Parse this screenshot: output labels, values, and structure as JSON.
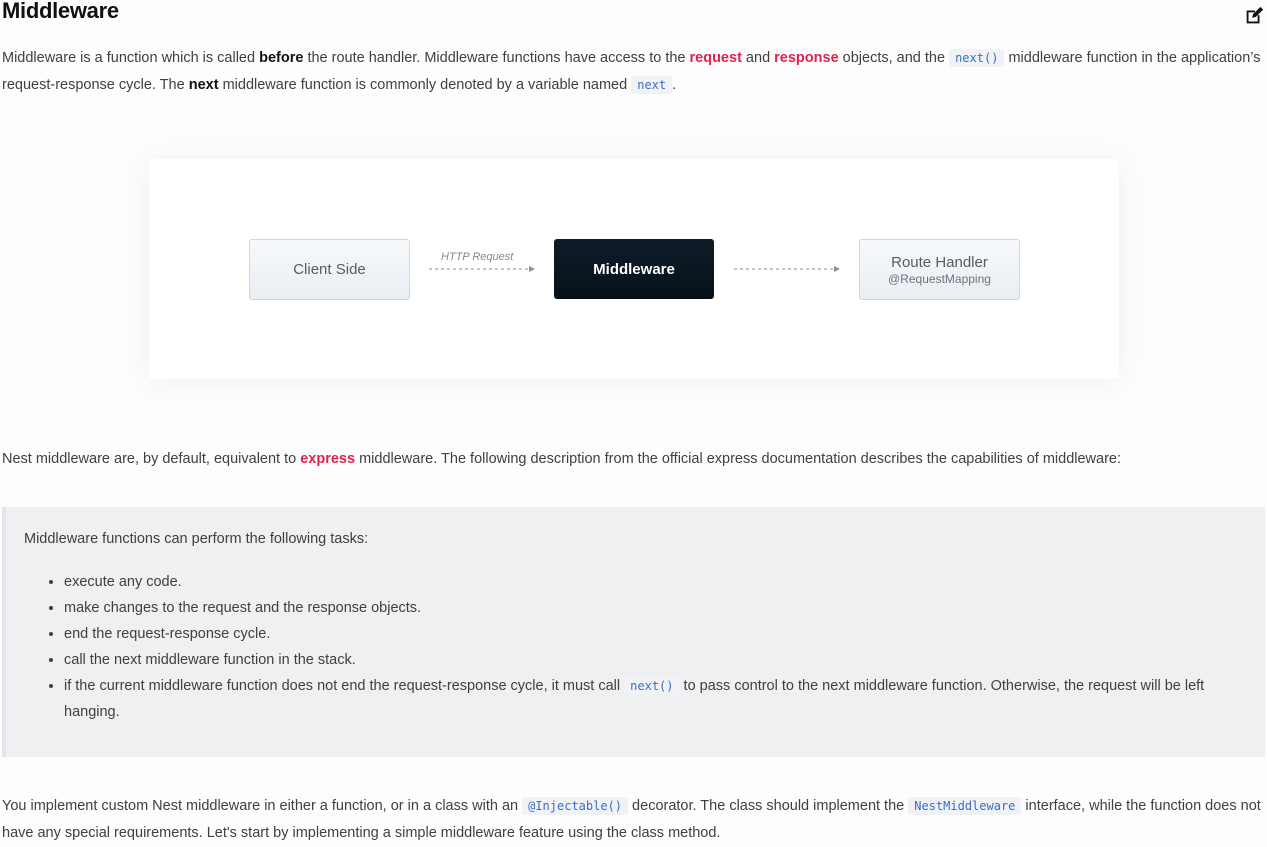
{
  "title": "Middleware",
  "intro": {
    "t1": "Middleware is a function which is called ",
    "b1": "before",
    "t2": " the route handler. Middleware functions have access to the ",
    "link1": "request",
    "t3": " and ",
    "link2": "response",
    "t4": " objects, and the ",
    "code1": "next()",
    "t5": " middleware function in the application’s request-response cycle. The ",
    "b2": "next",
    "t6": " middleware function is commonly denoted by a variable named ",
    "code2": "next",
    "t7": "."
  },
  "diagram": {
    "client": "Client Side",
    "arrow_label": "HTTP Request",
    "middleware": "Middleware",
    "route_title": "Route Handler",
    "route_sub": "@RequestMapping"
  },
  "p2": {
    "t1": "Nest middleware are, by default, equivalent to ",
    "link": "express",
    "t2": " middleware. The following description from the official express documentation describes the capabilities of middleware:"
  },
  "quote": {
    "lead": "Middleware functions can perform the following tasks:",
    "items": [
      "execute any code.",
      "make changes to the request and the response objects.",
      "end the request-response cycle.",
      "call the next middleware function in the stack."
    ],
    "last": {
      "t1": "if the current middleware function does not end the request-response cycle, it must call ",
      "code": "next()",
      "t2": " to pass control to the next middleware function. Otherwise, the request will be left hanging."
    }
  },
  "p3": {
    "t1": "You implement custom Nest middleware in either a function, or in a class with an ",
    "code1": "@Injectable()",
    "t2": " decorator. The class should implement the ",
    "code2": "NestMiddleware",
    "t3": " interface, while the function does not have any special requirements. Let's start by implementing a simple middleware feature using the class method."
  },
  "colors": {
    "link": "#e0234e",
    "code": "#3a6fc4",
    "middleware_box": "#0a1620"
  },
  "icons": {
    "edit": "edit-icon"
  }
}
